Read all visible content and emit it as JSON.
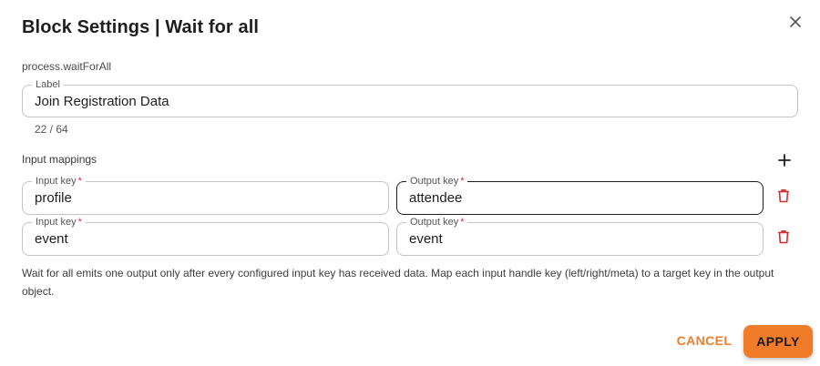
{
  "dialog": {
    "title": "Block Settings | Wait for all",
    "close_icon": "close-icon",
    "block_type": "process.waitForAll"
  },
  "label_field": {
    "legend": "Label",
    "value": "Join Registration Data",
    "counter": "22 / 64"
  },
  "input_mappings": {
    "section_label": "Input mappings",
    "add_icon": "plus-icon",
    "delete_icon": "trash-icon",
    "rows": [
      {
        "input_legend": "Input key",
        "input_value": "profile",
        "output_legend": "Output key",
        "output_value": "attendee"
      },
      {
        "input_legend": "Input key",
        "input_value": "event",
        "output_legend": "Output key",
        "output_value": "event"
      }
    ],
    "required_marker": "*"
  },
  "help_text": "Wait for all emits one output only after every configured input key has received data. Map each input handle key (left/right/meta) to a target key in the output object.",
  "actions": {
    "cancel_label": "CANCEL",
    "apply_label": "APPLY"
  },
  "colors": {
    "accent": "#f07c2a",
    "danger": "#d32f2f"
  }
}
